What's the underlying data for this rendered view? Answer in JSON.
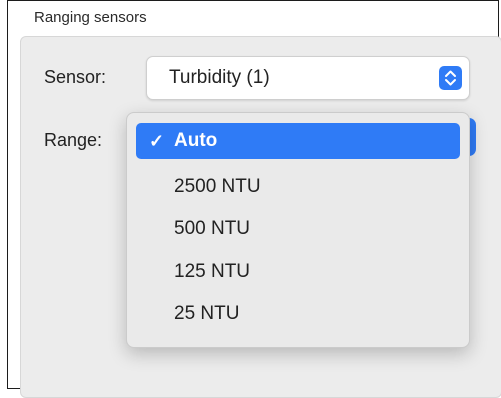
{
  "group": {
    "title": "Ranging sensors"
  },
  "sensor": {
    "label": "Sensor:",
    "value": "Turbidity (1)"
  },
  "range": {
    "label": "Range:",
    "options": [
      "Auto",
      "2500 NTU",
      "500 NTU",
      "125 NTU",
      "25 NTU"
    ],
    "selected": "Auto"
  },
  "icons": {
    "check": "✓"
  },
  "colors": {
    "accent": "#2f7bf6"
  }
}
